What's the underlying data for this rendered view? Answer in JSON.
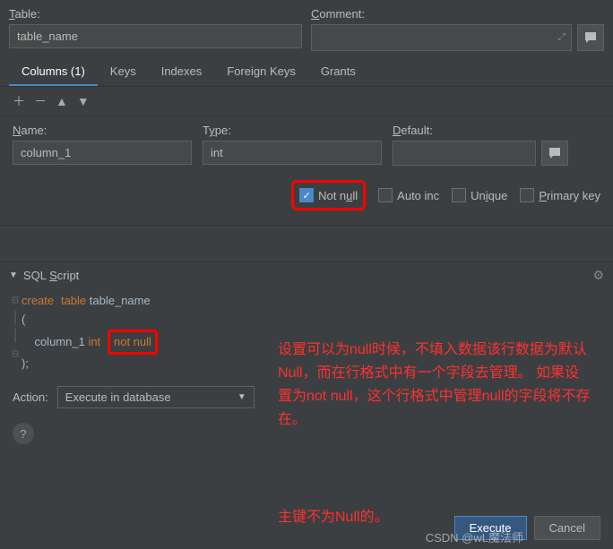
{
  "labels": {
    "table": "Table:",
    "comment": "Comment:",
    "name": "Name:",
    "type": "Type:",
    "default": "Default:",
    "notnull": "Not null",
    "autoinc": "Auto inc",
    "unique": "Unique",
    "primarykey": "Primary key",
    "sqlscript": "SQL Script",
    "action": "Action:"
  },
  "values": {
    "table_name": "table_name",
    "col_name": "column_1",
    "col_type": "int",
    "col_default": "",
    "action_select": "Execute in database"
  },
  "tabs": {
    "columns": "Columns (1)",
    "keys": "Keys",
    "indexes": "Indexes",
    "fkeys": "Foreign Keys",
    "grants": "Grants"
  },
  "sql": {
    "l1a": "create",
    "l1b": "table",
    "l1c": " table_name",
    "l2": "(",
    "l3a": "    column_1 ",
    "l3b": "int",
    "l3nn": "not null",
    "l4": ");"
  },
  "buttons": {
    "execute": "Execute",
    "cancel": "Cancel"
  },
  "annotations": {
    "note1": "设置可以为null时候，不填入数据该行数据为默认Null，而在行格式中有一个字段去管理。\n如果设置为not null，这个行格式中管理null的字段将不存在。",
    "note2": "主键不为Null的。"
  },
  "watermark": "CSDN @wL魔法师"
}
